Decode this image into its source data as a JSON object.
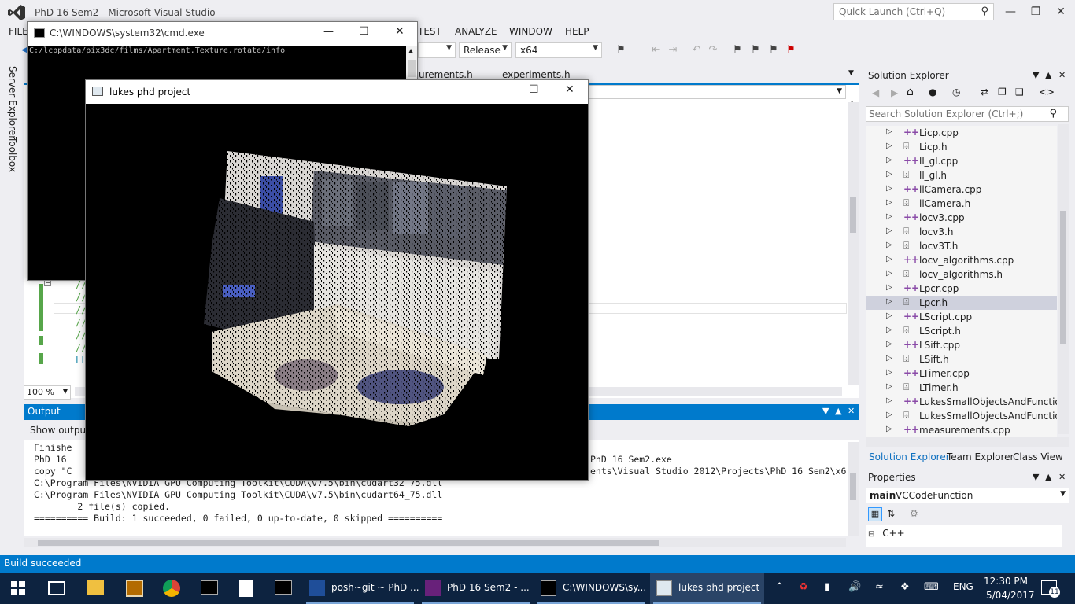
{
  "vs": {
    "title": "PhD 16 Sem2 - Microsoft Visual Studio",
    "quick_launch_placeholder": "Quick Launch (Ctrl+Q)"
  },
  "menu": {
    "file": "FILE",
    "test": "TEST",
    "analyze": "ANALYZE",
    "window": "WINDOW",
    "help": "HELP"
  },
  "toolbar": {
    "configuration": "Release",
    "platform": "x64"
  },
  "side_tabs": {
    "server_explorer": "Server Explorer",
    "toolbox": "Toolbox"
  },
  "editor": {
    "tabs": [
      "urements.h",
      "experiments.h"
    ],
    "code_lines": [
      "//",
      "//",
      "//",
      "//",
      "//",
      "//",
      "LL"
    ],
    "zoom": "100 %"
  },
  "output": {
    "title": "Output",
    "show_output_from": "Show output",
    "lines": [
      "Finishe",
      "PhD 16",
      "copy \"C",
      "C:\\Program Files\\NVIDIA GPU Computing Toolkit\\CUDA\\v7.5\\bin\\cudart32_75.dll",
      "C:\\Program Files\\NVIDIA GPU Computing Toolkit\\CUDA\\v7.5\\bin\\cudart64_75.dll",
      "        2 file(s) copied.",
      "========== Build: 1 succeeded, 0 failed, 0 up-to-date, 0 skipped =========="
    ],
    "right_fragments": [
      "PhD 16 Sem2.exe",
      "ents\\Visual Studio 2012\\Projects\\PhD 16 Sem2\\x6"
    ]
  },
  "solution_explorer": {
    "title": "Solution Explorer",
    "search_placeholder": "Search Solution Explorer (Ctrl+;)",
    "files": [
      {
        "name": "Licp.cpp",
        "kind": "cpp"
      },
      {
        "name": "Licp.h",
        "kind": "h"
      },
      {
        "name": "ll_gl.cpp",
        "kind": "cpp"
      },
      {
        "name": "ll_gl.h",
        "kind": "h"
      },
      {
        "name": "llCamera.cpp",
        "kind": "cpp"
      },
      {
        "name": "llCamera.h",
        "kind": "h"
      },
      {
        "name": "locv3.cpp",
        "kind": "cpp"
      },
      {
        "name": "locv3.h",
        "kind": "h"
      },
      {
        "name": "locv3T.h",
        "kind": "h"
      },
      {
        "name": "locv_algorithms.cpp",
        "kind": "cpp"
      },
      {
        "name": "locv_algorithms.h",
        "kind": "h"
      },
      {
        "name": "Lpcr.cpp",
        "kind": "cpp"
      },
      {
        "name": "Lpcr.h",
        "kind": "h",
        "selected": true
      },
      {
        "name": "LScript.cpp",
        "kind": "cpp"
      },
      {
        "name": "LScript.h",
        "kind": "h"
      },
      {
        "name": "LSift.cpp",
        "kind": "cpp"
      },
      {
        "name": "LSift.h",
        "kind": "h"
      },
      {
        "name": "LTimer.cpp",
        "kind": "cpp"
      },
      {
        "name": "LTimer.h",
        "kind": "h"
      },
      {
        "name": "LukesSmallObjectsAndFunctions.",
        "kind": "cpp"
      },
      {
        "name": "LukesSmallObjectsAndFunctions.",
        "kind": "h"
      },
      {
        "name": "measurements.cpp",
        "kind": "cpp"
      }
    ],
    "tabs": {
      "solution": "Solution Explorer",
      "team": "Team Explorer",
      "class": "Class View"
    }
  },
  "properties": {
    "title": "Properties",
    "object": "main",
    "type": "VCCodeFunction",
    "category": "C++"
  },
  "status": {
    "text": "Build succeeded"
  },
  "cmd": {
    "title": "C:\\WINDOWS\\system32\\cmd.exe",
    "line": "C:/lcppdata/pix3dc/films/Apartment.Texture.rotate/info"
  },
  "phd_window": {
    "title": "lukes phd project"
  },
  "taskbar": {
    "apps": [
      {
        "label": "posh~git ~ PhD ...",
        "icon": "powershell-icon"
      },
      {
        "label": "PhD 16 Sem2 - ...",
        "icon": "visual-studio-icon"
      },
      {
        "label": "C:\\WINDOWS\\sy...",
        "icon": "cmd-icon"
      },
      {
        "label": "lukes phd project",
        "icon": "app-window-icon"
      }
    ],
    "language": "ENG",
    "time": "12:30 PM",
    "date": "5/04/2017",
    "notifications": "11"
  },
  "colors": {
    "accent": "#007acc",
    "taskbar": "#0d2340",
    "selected_row": "#cfd1dd"
  }
}
